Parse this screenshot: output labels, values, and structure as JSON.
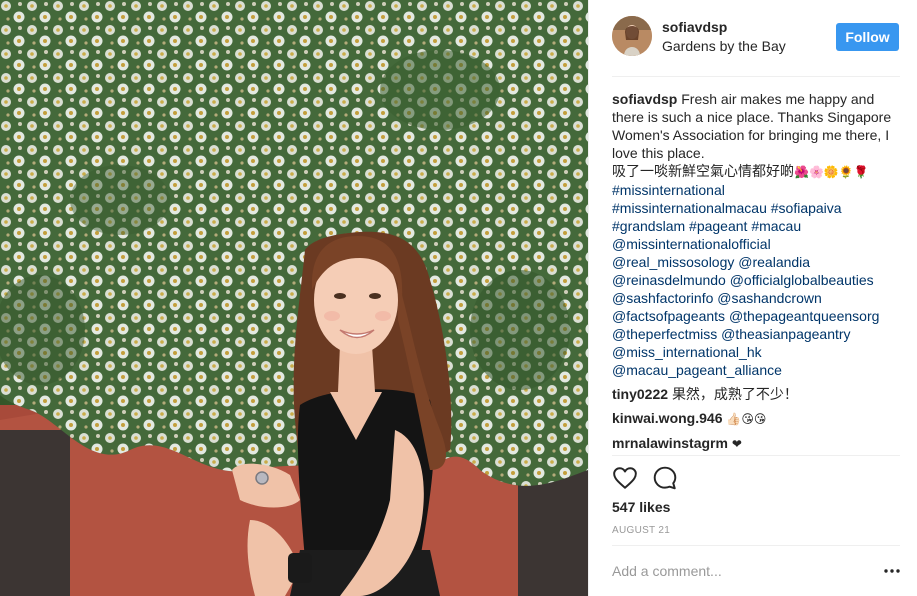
{
  "post": {
    "username": "sofiavdsp",
    "location": "Gardens by the Bay",
    "follow_label": "Follow",
    "caption": {
      "username": "sofiavdsp",
      "text": "Fresh air makes me happy and there is such a nice place. Thanks Singapore Women's Association for bringing me there, I love this place.",
      "chinese_text": "吸了一啖新鮮空氣心情都好啲",
      "emojis": "🌺🌸🌼🌻🌹",
      "hashtags": [
        "#missinternational",
        "#missinternationalmacau #sofiapaiva",
        "#grandslam #pageant #macau",
        "@missinternationalofficial",
        "@real_missosology @realandia",
        "@reinasdelmundo @officialglobalbeauties",
        "@sashfactorinfo @sashandcrown",
        "@factsofpageants @thepageantqueensorg",
        "@theperfectmiss @theasianpageantry",
        "@miss_international_hk",
        "@macau_pageant_alliance"
      ]
    },
    "comments": [
      {
        "username": "tiny0222",
        "text": "果然，成熟了不少！"
      },
      {
        "username": "kinwai.wong.946",
        "text": "👍🏻😘😘"
      },
      {
        "username": "mrnalawinstagrm",
        "text": "❤"
      }
    ],
    "likes": "547 likes",
    "date": "AUGUST 21",
    "add_comment_placeholder": "Add a comment...",
    "icons": {
      "like": "heart-icon",
      "comment": "comment-icon",
      "more": "more-options-icon"
    },
    "colors": {
      "follow_button": "#3897f0",
      "hashtag": "#003569",
      "muted": "#999999"
    }
  }
}
